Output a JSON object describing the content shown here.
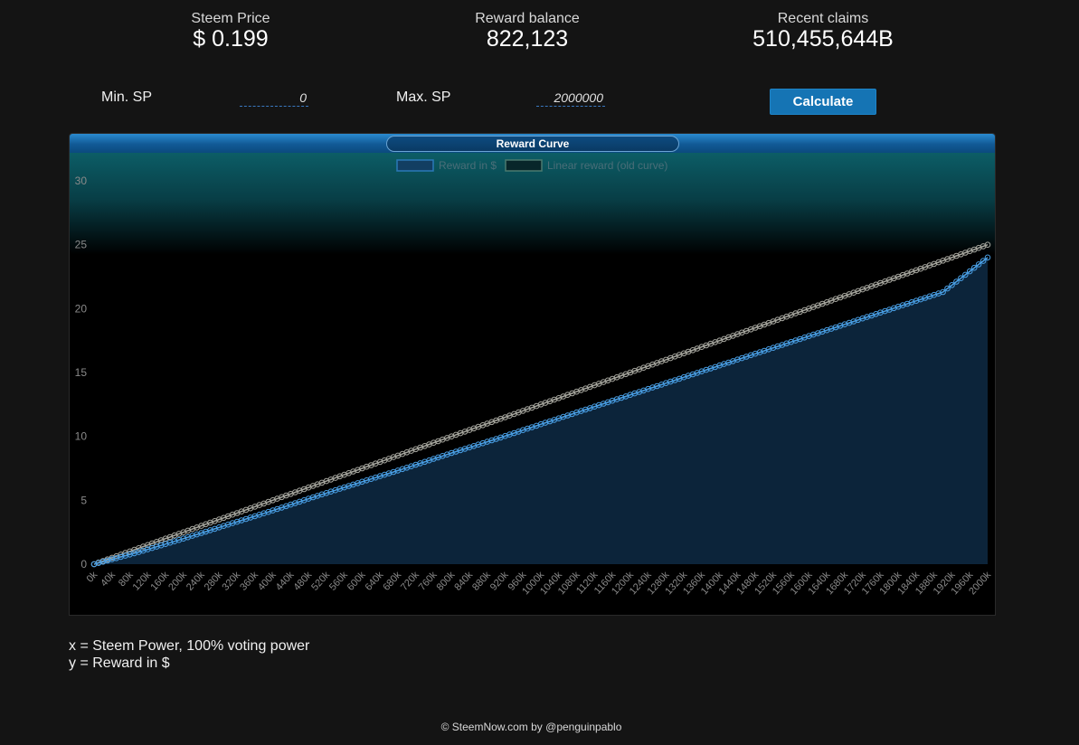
{
  "stats": {
    "price_label": "Steem Price",
    "price_value": "$ 0.199",
    "balance_label": "Reward balance",
    "balance_value": "822,123",
    "claims_label": "Recent claims",
    "claims_value": "510,455,644B"
  },
  "inputs": {
    "min_label": "Min. SP",
    "min_value": "0",
    "max_label": "Max. SP",
    "max_value": "2000000",
    "calculate_label": "Calculate"
  },
  "notes": {
    "x_desc": "x = Steem Power, 100% voting power",
    "y_desc": "y = Reward in $"
  },
  "footer": "© SteemNow.com by @penguinpablo",
  "colors": {
    "reward_series": "#4aa0e6",
    "linear_series": "#a8a8a0",
    "header_blue": "#1574b4"
  },
  "chart_data": {
    "type": "line",
    "title": "Reward Curve",
    "xlabel": "",
    "ylabel": "",
    "xlim": [
      0,
      2000000
    ],
    "ylim": [
      0,
      30
    ],
    "y_ticks": [
      0,
      5,
      10,
      15,
      20,
      25,
      30
    ],
    "x_tick_labels": [
      "0k",
      "40k",
      "80k",
      "120k",
      "160k",
      "200k",
      "240k",
      "280k",
      "320k",
      "360k",
      "400k",
      "440k",
      "480k",
      "520k",
      "560k",
      "600k",
      "640k",
      "680k",
      "720k",
      "760k",
      "800k",
      "840k",
      "880k",
      "920k",
      "960k",
      "1000k",
      "1040k",
      "1080k",
      "1120k",
      "1160k",
      "1200k",
      "1240k",
      "1280k",
      "1320k",
      "1360k",
      "1400k",
      "1440k",
      "1480k",
      "1520k",
      "1560k",
      "1600k",
      "1640k",
      "1680k",
      "1720k",
      "1760k",
      "1800k",
      "1840k",
      "1880k",
      "1920k",
      "1960k",
      "2000k"
    ],
    "legend_position": "top",
    "grid": false,
    "series": [
      {
        "name": "Reward in $",
        "x": [
          0,
          100000,
          200000,
          300000,
          400000,
          500000,
          600000,
          700000,
          800000,
          900000,
          1000000,
          1100000,
          1200000,
          1300000,
          1400000,
          1500000,
          1600000,
          1700000,
          1800000,
          1900000,
          2000000
        ],
        "values": [
          0,
          0.95,
          2.0,
          3.1,
          4.2,
          5.35,
          6.45,
          7.55,
          8.7,
          9.8,
          10.95,
          12.1,
          13.25,
          14.4,
          15.55,
          16.7,
          17.85,
          19.0,
          20.15,
          21.3,
          24.0
        ]
      },
      {
        "name": "Linear reward (old curve)",
        "x": [
          0,
          2000000
        ],
        "values": [
          0,
          25.0
        ]
      }
    ]
  }
}
